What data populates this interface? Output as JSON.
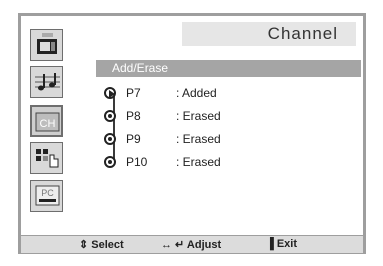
{
  "header": {
    "title": "Channel"
  },
  "section": {
    "label": "Add/Erase"
  },
  "channels": [
    {
      "name": "P7",
      "status": ": Added"
    },
    {
      "name": "P8",
      "status": ": Erased"
    },
    {
      "name": "P9",
      "status": ": Erased"
    },
    {
      "name": "P10",
      "status": ": Erased"
    }
  ],
  "sidebar": {
    "items": [
      {
        "icon": "picture-icon"
      },
      {
        "icon": "sound-icon"
      },
      {
        "icon": "channel-icon",
        "label": "CH",
        "active": true
      },
      {
        "icon": "setup-icon"
      },
      {
        "icon": "pc-icon",
        "label": "PC"
      }
    ]
  },
  "footer": {
    "select": "⇕ Select",
    "adjust": "↔ ↵ Adjust",
    "exit": "▐ Exit"
  }
}
